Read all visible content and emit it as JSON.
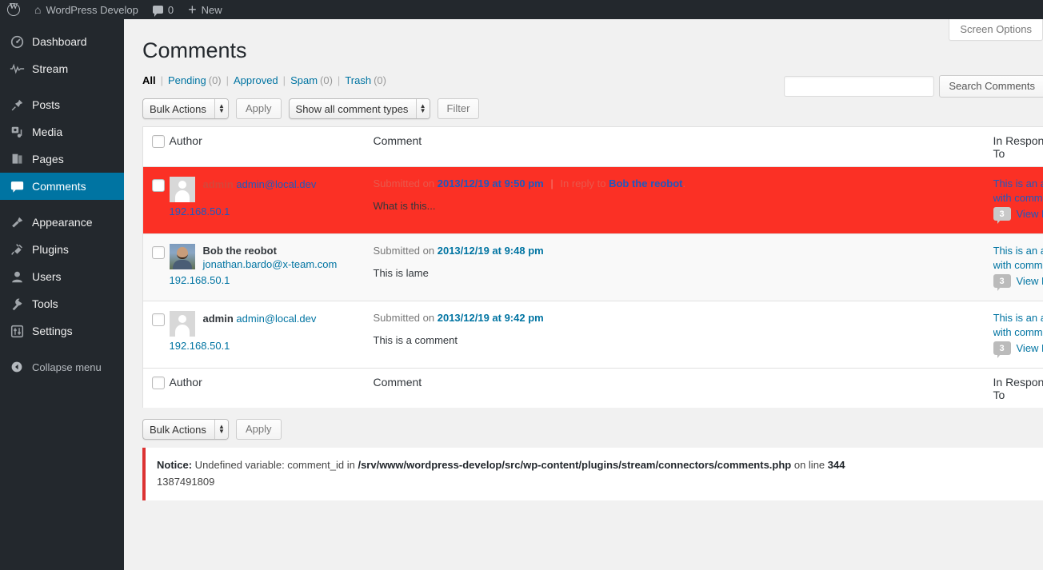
{
  "adminbar": {
    "logo_icon": "wordpress-logo-icon",
    "site_home_icon": "home-icon",
    "site_name": "WordPress Develop",
    "comments_icon": "comment-bubble-icon",
    "comments_count": "0",
    "new_icon": "plus-icon",
    "new_label": "New"
  },
  "sidebar": {
    "items": [
      {
        "label": "Dashboard",
        "icon": "dashboard-gauge-icon",
        "current": false
      },
      {
        "label": "Stream",
        "icon": "stream-pulse-icon",
        "current": false
      },
      {
        "label": "Posts",
        "icon": "pin-icon",
        "current": false
      },
      {
        "label": "Media",
        "icon": "media-camera-icon",
        "current": false
      },
      {
        "label": "Pages",
        "icon": "pages-icon",
        "current": false
      },
      {
        "label": "Comments",
        "icon": "comment-bubble-icon",
        "current": true
      },
      {
        "label": "Appearance",
        "icon": "paintbrush-icon",
        "current": false
      },
      {
        "label": "Plugins",
        "icon": "plug-icon",
        "current": false
      },
      {
        "label": "Users",
        "icon": "user-icon",
        "current": false
      },
      {
        "label": "Tools",
        "icon": "wrench-icon",
        "current": false
      },
      {
        "label": "Settings",
        "icon": "settings-sliders-icon",
        "current": false
      }
    ],
    "collapse": {
      "label": "Collapse menu",
      "icon": "collapse-arrow-icon"
    }
  },
  "screen_meta": {
    "screen_options_label": "Screen Options"
  },
  "page": {
    "title": "Comments"
  },
  "filters": {
    "all": {
      "label": "All",
      "count": ""
    },
    "pending": {
      "label": "Pending",
      "count": "(0)"
    },
    "approved": {
      "label": "Approved",
      "count": ""
    },
    "spam": {
      "label": "Spam",
      "count": "(0)"
    },
    "trash": {
      "label": "Trash",
      "count": "(0)"
    },
    "divider": "|"
  },
  "search": {
    "value": "",
    "button_label": "Search Comments"
  },
  "tablenav_top": {
    "bulk_actions_label": "Bulk Actions",
    "apply_label": "Apply",
    "comment_types_label": "Show all comment types",
    "filter_label": "Filter"
  },
  "tablenav_bottom": {
    "bulk_actions_label": "Bulk Actions",
    "apply_label": "Apply"
  },
  "table": {
    "columns": {
      "author": "Author",
      "comment": "Comment",
      "response": "In Response To"
    },
    "rows": [
      {
        "highlighted": true,
        "avatar_type": "mystery",
        "author_name": "admin",
        "author_email": "admin@local.dev",
        "author_ip": "192.168.50.1",
        "submitted_prefix": "Submitted on",
        "submitted_date": "2013/12/19 at 9:50 pm",
        "reply_prefix": "In reply to",
        "reply_to": "Bob the reobot",
        "reply_suffix": ".",
        "comment_text": "What is this...",
        "response_line1": "This is an aw",
        "response_line2": "with comm",
        "response_count": "3",
        "response_view": "View Po"
      },
      {
        "highlighted": false,
        "avatar_type": "photo",
        "author_name": "Bob the reobot",
        "author_email": "jonathan.bardo@x-team.com",
        "author_ip": "192.168.50.1",
        "submitted_prefix": "Submitted on",
        "submitted_date": "2013/12/19 at 9:48 pm",
        "reply_prefix": "",
        "reply_to": "",
        "reply_suffix": "",
        "comment_text": "This is lame",
        "response_line1": "This is an aw",
        "response_line2": "with comm",
        "response_count": "3",
        "response_view": "View Po"
      },
      {
        "highlighted": false,
        "avatar_type": "mystery",
        "author_name": "admin",
        "author_email": "admin@local.dev",
        "author_ip": "192.168.50.1",
        "submitted_prefix": "Submitted on",
        "submitted_date": "2013/12/19 at 9:42 pm",
        "reply_prefix": "",
        "reply_to": "",
        "reply_suffix": "",
        "comment_text": "This is a comment",
        "response_line1": "This is an aw",
        "response_line2": "with comm",
        "response_count": "3",
        "response_view": "View Po"
      }
    ]
  },
  "notice": {
    "label": "Notice:",
    "message": " Undefined variable: comment_id in ",
    "file": "/srv/www/wordpress-develop/src/wp-content/plugins/stream/connectors/comments.php",
    "on_line": " on line ",
    "line_number": "344",
    "extra": "1387491809"
  },
  "colors": {
    "admin_bar": "#23282d",
    "sidebar": "#23282d",
    "accent_blue": "#0074a2",
    "highlight_red": "#fb3025",
    "notice_red": "#dc3232",
    "body_bg": "#f1f1f1"
  }
}
